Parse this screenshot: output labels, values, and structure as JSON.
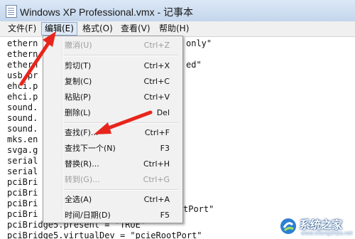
{
  "window": {
    "title": "Windows XP Professional.vmx - 记事本"
  },
  "menubar": {
    "items": [
      {
        "label": "文件(F)"
      },
      {
        "label": "编辑(E)"
      },
      {
        "label": "格式(O)"
      },
      {
        "label": "查看(V)"
      },
      {
        "label": "帮助(H)"
      }
    ]
  },
  "editor": {
    "lines": [
      "ethern",
      "ethern",
      "ethern",
      "usb.pr",
      "ehci.p",
      "ehci.p",
      "sound.",
      "sound.",
      "sound.",
      "mks.en",
      "svga.g",
      "serial",
      "serial",
      "pciBri",
      "pciBri",
      "pciBri",
      "pciBri",
      "pciBridge5.present = \"TRUE\"",
      "pciBridge5.virtualDev = \"pcieRootPort\""
    ],
    "fragments": [
      "only\"",
      "ed\"",
      "tPort\""
    ]
  },
  "edit_menu": {
    "items": [
      {
        "label": "撤消(U)",
        "shortcut": "Ctrl+Z"
      },
      {
        "label": "剪切(T)",
        "shortcut": "Ctrl+X"
      },
      {
        "label": "复制(C)",
        "shortcut": "Ctrl+C"
      },
      {
        "label": "粘贴(P)",
        "shortcut": "Ctrl+V"
      },
      {
        "label": "删除(L)",
        "shortcut": "Del"
      },
      {
        "label": "查找(F)...",
        "shortcut": "Ctrl+F"
      },
      {
        "label": "查找下一个(N)",
        "shortcut": "F3"
      },
      {
        "label": "替换(R)...",
        "shortcut": "Ctrl+H"
      },
      {
        "label": "转到(G)...",
        "shortcut": "Ctrl+G"
      },
      {
        "label": "全选(A)",
        "shortcut": "Ctrl+A"
      },
      {
        "label": "时间/日期(D)",
        "shortcut": "F5"
      }
    ]
  },
  "watermark": {
    "name": "系统之家",
    "url": "www.xitongzhijia.net"
  },
  "colors": {
    "arrow": "#e8251c",
    "menu_active_border": "#8faacc",
    "title_bar": "#c4d6ec"
  }
}
